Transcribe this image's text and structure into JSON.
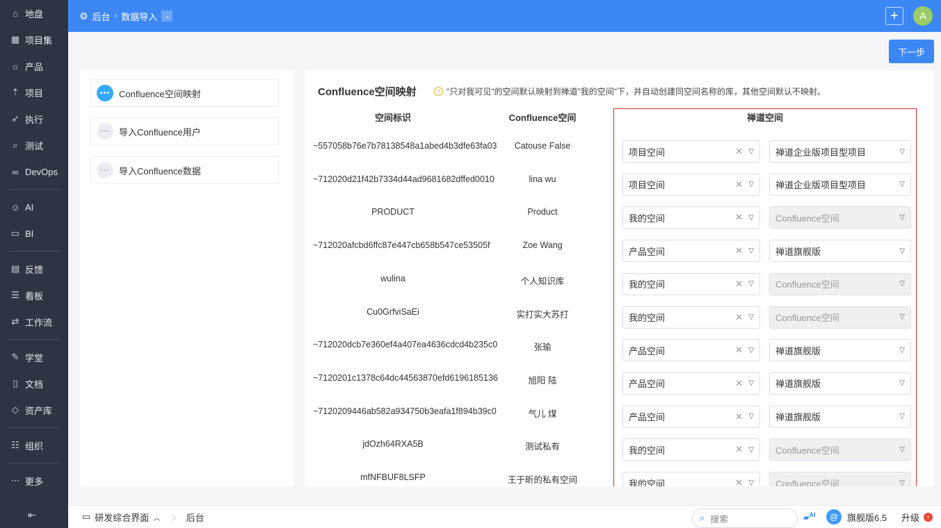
{
  "sidebar": {
    "items": [
      {
        "label": "地盘",
        "icon": "home-icon",
        "glyph": "⌂"
      },
      {
        "label": "项目集",
        "icon": "grid-icon",
        "glyph": "▦"
      },
      {
        "label": "产品",
        "icon": "bulb-icon",
        "glyph": "☼"
      },
      {
        "label": "项目",
        "icon": "rocket-icon",
        "glyph": "⇡"
      },
      {
        "label": "执行",
        "icon": "run-icon",
        "glyph": "➶"
      },
      {
        "label": "测试",
        "icon": "search-icon",
        "glyph": "⌕"
      },
      {
        "label": "DevOps",
        "icon": "infinity-icon",
        "glyph": "∞"
      },
      {
        "label": "AI",
        "icon": "robot-icon",
        "glyph": "☺"
      },
      {
        "label": "BI",
        "icon": "chart-icon",
        "glyph": "▭"
      },
      {
        "label": "反馈",
        "icon": "feedback-icon",
        "glyph": "▤"
      },
      {
        "label": "看板",
        "icon": "board-icon",
        "glyph": "☰"
      },
      {
        "label": "工作流",
        "icon": "workflow-icon",
        "glyph": "⇄"
      },
      {
        "label": "学堂",
        "icon": "school-icon",
        "glyph": "✎"
      },
      {
        "label": "文档",
        "icon": "doc-icon",
        "glyph": "▯"
      },
      {
        "label": "资产库",
        "icon": "diamond-icon",
        "glyph": "◇"
      },
      {
        "label": "组织",
        "icon": "users-icon",
        "glyph": "☷"
      },
      {
        "label": "更多",
        "icon": "more-icon",
        "glyph": "⋯"
      }
    ]
  },
  "topbar": {
    "crumb1": "后台",
    "crumb2": "数据导入",
    "avatar": "A"
  },
  "next_label": "下一步",
  "steps": [
    "Confluence空间映射",
    "导入Confluence用户",
    "导入Confluence数据"
  ],
  "main": {
    "title": "Confluence空间映射",
    "tip": "\"只对我可见\"的空间默认映射到禅道\"我的空间\"下，并自动创建同空间名称的库，其他空间默认不映射。",
    "headers": [
      "空间标识",
      "Confluence空间",
      "禅道空间"
    ],
    "rows": [
      {
        "id": "~557058b76e7b78138548a1abed4b3dfe63fa03",
        "name": "Catouse False",
        "type": "项目空间",
        "target": "禅道企业版项目型项目",
        "disabled": false
      },
      {
        "id": "~712020d21f42b7334d44ad9681682dffed0010",
        "name": "lina wu",
        "type": "项目空间",
        "target": "禅道企业版项目型项目",
        "disabled": false
      },
      {
        "id": "PRODUCT",
        "name": "Product",
        "type": "我的空间",
        "target": "Confluence空间",
        "disabled": true
      },
      {
        "id": "~712020afcbd6ffc87e447cb658b547ce53505f",
        "name": "Zoe Wang",
        "type": "产品空间",
        "target": "禅道旗舰版",
        "disabled": false
      },
      {
        "id": "wulina",
        "name": "个人知识库",
        "type": "我的空间",
        "target": "Confluence空间",
        "disabled": true
      },
      {
        "id": "Cu0GrfviSaEi",
        "name": "实打实大苏打",
        "type": "我的空间",
        "target": "Confluence空间",
        "disabled": true
      },
      {
        "id": "~712020dcb7e360ef4a407ea4636cdcd4b235c0",
        "name": "张瑜",
        "type": "产品空间",
        "target": "禅道旗舰版",
        "disabled": false
      },
      {
        "id": "~7120201c1378c64dc44563870efd6196185136",
        "name": "旭阳 陆",
        "type": "产品空间",
        "target": "禅道旗舰版",
        "disabled": false
      },
      {
        "id": "~7120209446ab582a934750b3eafa1f894b39c0",
        "name": "气儿 煤",
        "type": "产品空间",
        "target": "禅道旗舰版",
        "disabled": false
      },
      {
        "id": "jdOzh64RXA5B",
        "name": "测试私有",
        "type": "我的空间",
        "target": "Confluence空间",
        "disabled": true
      },
      {
        "id": "mfNFBUF8LSFP",
        "name": "王于昕的私有空间",
        "type": "我的空间",
        "target": "Confluence空间",
        "disabled": true
      }
    ]
  },
  "bottom": {
    "workspace": "研发综合界面",
    "crumb": "后台",
    "search_placeholder": "搜索",
    "edition": "旗舰版6.5",
    "upgrade": "升级",
    "ai": "AI"
  }
}
